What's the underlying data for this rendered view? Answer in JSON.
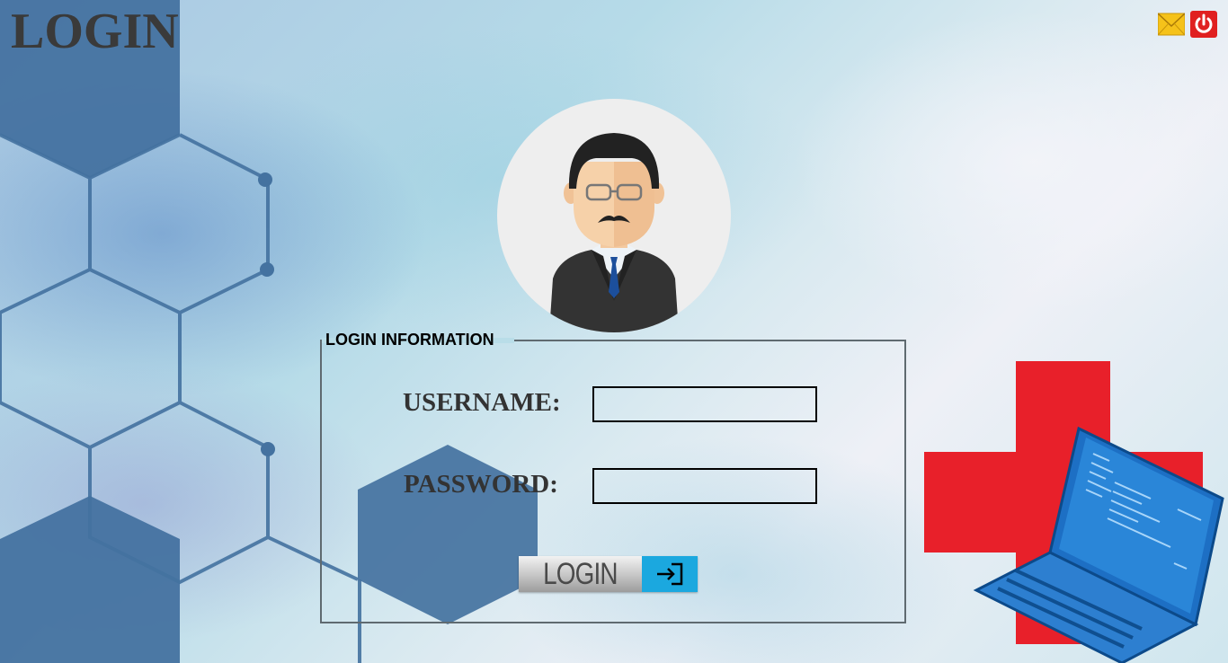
{
  "header": {
    "title": "LOGIN",
    "icons": [
      "mail-icon",
      "power-icon"
    ]
  },
  "login_form": {
    "group_title": "LOGIN INFORMATION",
    "username_label": "USERNAME:",
    "username_value": "",
    "password_label": "PASSWORD:",
    "password_value": "",
    "submit_label": "LOGIN",
    "submit_icon": "sign-in-icon"
  },
  "colors": {
    "accent_button": "#1ba8df",
    "hexagon": "#4472a0",
    "red_cross": "#e8202a",
    "mail_icon": "#f5c21a",
    "power_icon": "#e02020"
  }
}
